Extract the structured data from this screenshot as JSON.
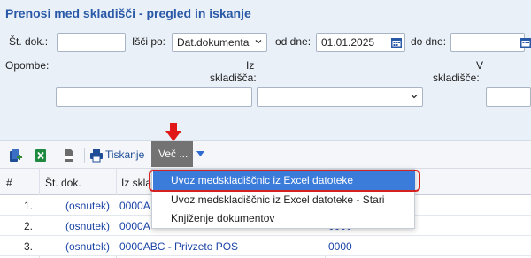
{
  "header": {
    "title": "Prenosi med skladišči - pregled in iskanje"
  },
  "filters": {
    "st_dok_label": "Št. dok.:",
    "st_dok_value": "",
    "isci_po_label": "Išči po:",
    "isci_po_value": "Dat.dokumenta",
    "od_dne_label": "od dne:",
    "od_dne_value": "01.01.2025",
    "do_dne_label": "do dne:",
    "do_dne_value": "",
    "opombe_label": "Opombe:",
    "opombe_value": "",
    "iz_skladisca_line1": "Iz",
    "iz_skladisca_line2": "skladišča:",
    "iz_skladisca_value": "",
    "v_skladisce_line1": "V",
    "v_skladisce_line2": "skladišče:",
    "v_skladisce_value": ""
  },
  "toolbar": {
    "print_label": "Tiskanje",
    "more_label": "Več ..."
  },
  "grid": {
    "headers": [
      "#",
      "Št. dok.",
      "Iz skla"
    ],
    "rows": [
      {
        "num": "1.",
        "doc": "(osnutek)",
        "from": "0000A",
        "to": ""
      },
      {
        "num": "2.",
        "doc": "(osnutek)",
        "from": "0000A",
        "to": "0000"
      },
      {
        "num": "3.",
        "doc": "(osnutek)",
        "from": "0000ABC - Privzeto POS",
        "to": "0000"
      }
    ]
  },
  "menu": {
    "items": [
      "Uvoz medskladiščnic iz Excel datoteke",
      "Uvoz medskladiščnic iz Excel datoteke - Stari",
      "Knjiženje dokumentov"
    ],
    "active_index": 0
  },
  "colors": {
    "title": "#2a5aa7",
    "menu_highlight": "#3b7cdb",
    "annotation_red": "#d52020"
  }
}
